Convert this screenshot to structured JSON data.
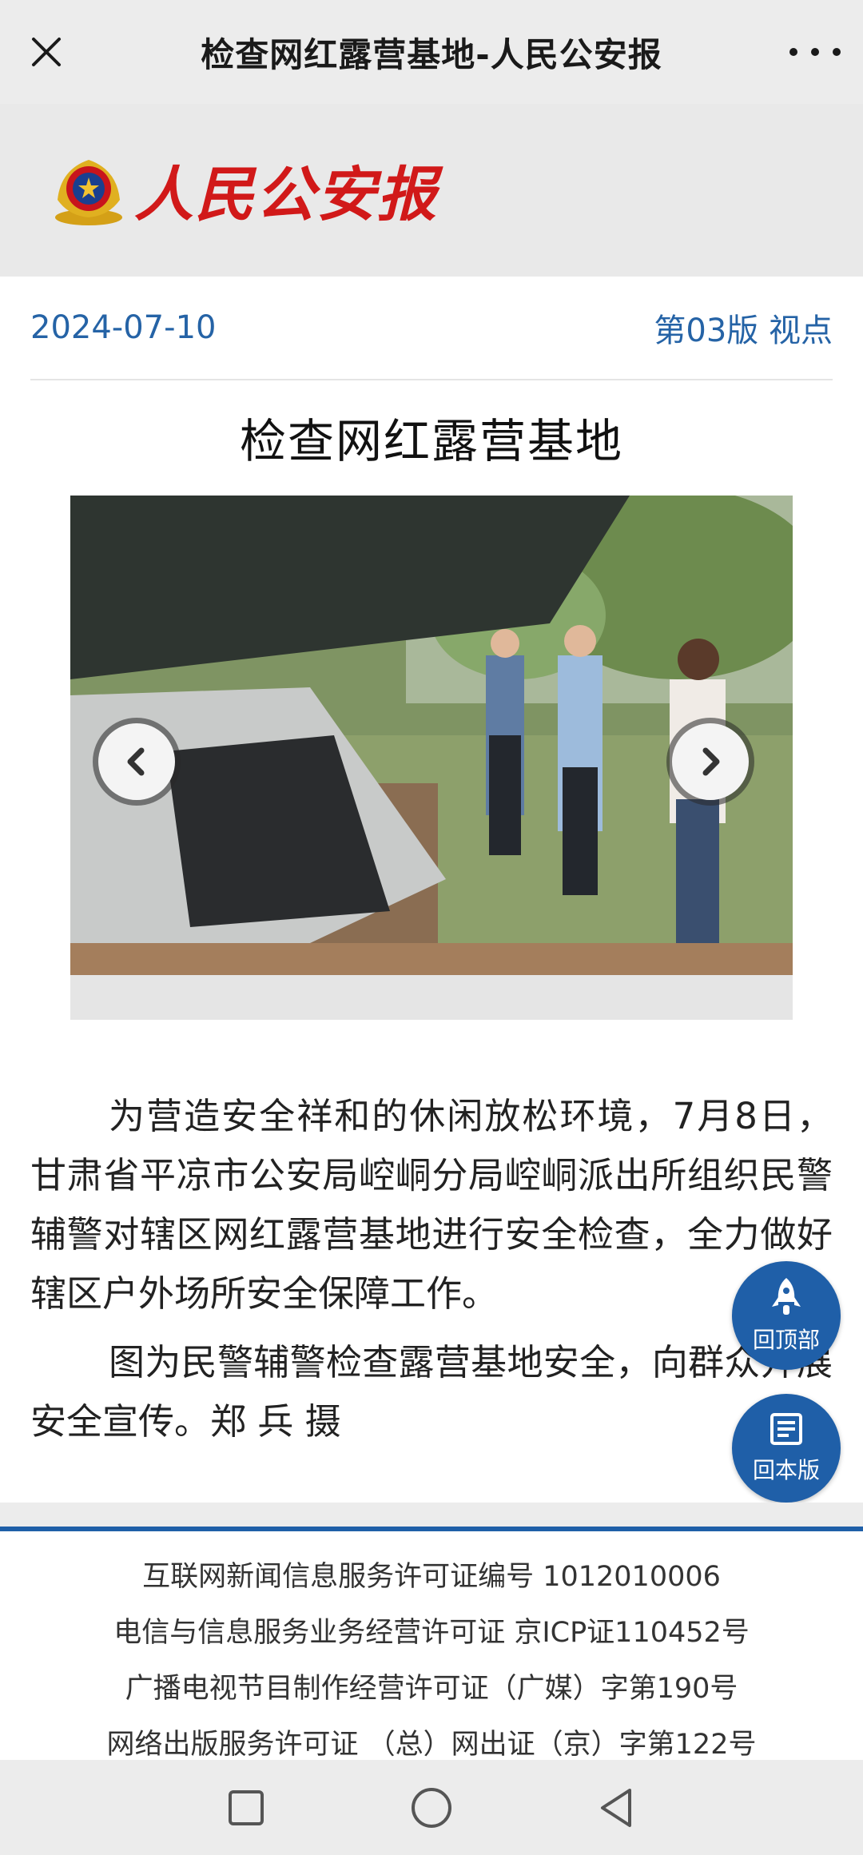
{
  "topbar": {
    "title": "检查网红露营基地-人民公安报",
    "close_icon": "close-icon",
    "more_icon": "more-dots-icon"
  },
  "brand": {
    "wordmark": "人民公安报",
    "emblem_icon": "police-emblem-icon"
  },
  "meta": {
    "date": "2024-07-10",
    "edition": "第03版 视点"
  },
  "article": {
    "headline": "检查网红露营基地",
    "paragraphs": [
      "为营造安全祥和的休闲放松环境，7月8日，甘肃省平凉市公安局崆峒分局崆峒派出所组织民警辅警对辖区网红露营基地进行安全检查，全力做好辖区户外场所安全保障工作。",
      "图为民警辅警检查露营基地安全，向群众开展安全宣传。郑 兵 摄"
    ]
  },
  "gallery": {
    "prev_icon": "chevron-left-icon",
    "next_icon": "chevron-right-icon"
  },
  "floating": {
    "back_to_top": "回顶部",
    "back_to_edition": "回本版"
  },
  "footer": {
    "lines": [
      "互联网新闻信息服务许可证编号 1012010006",
      "电信与信息服务业务经营许可证 京ICP证110452号",
      "广播电视节目制作经营许可证（广媒）字第190号",
      "网络出版服务许可证 （总）网出证（京）字第122号"
    ]
  },
  "colors": {
    "accent_blue": "#1f5fa8",
    "link_blue": "#2563a6",
    "brand_red": "#d11919",
    "topbar_bg": "#ececec"
  }
}
